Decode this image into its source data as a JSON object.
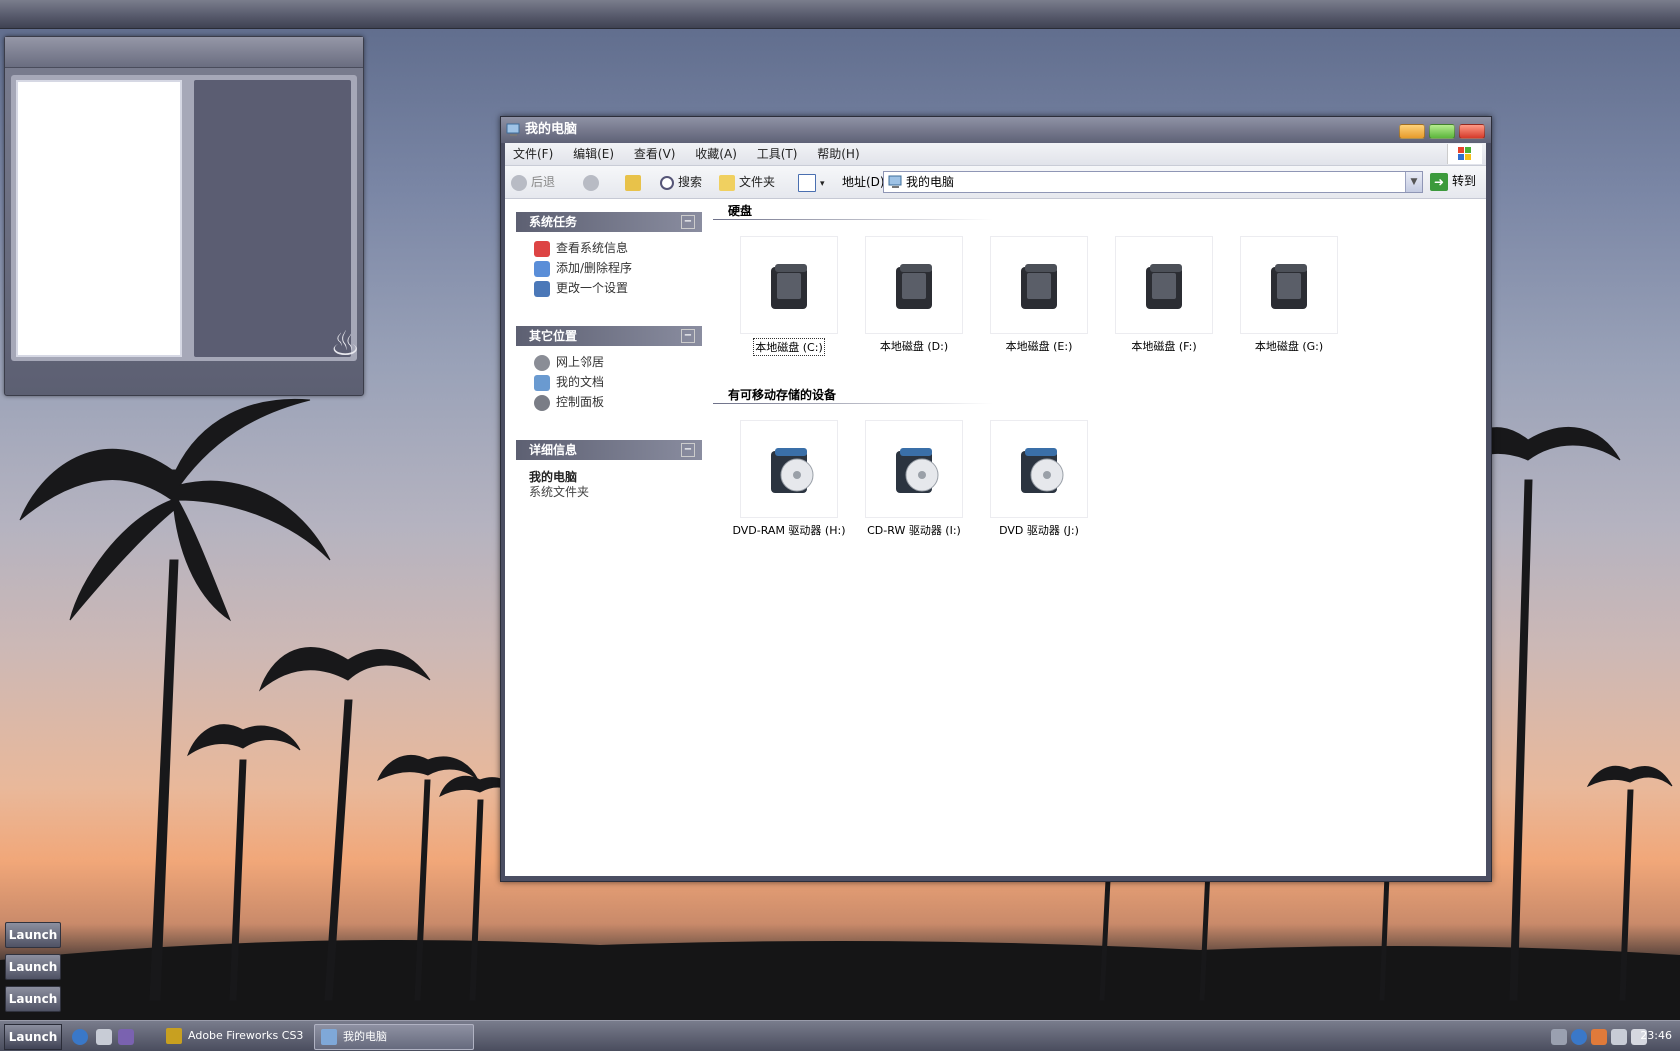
{
  "window": {
    "title": "我的电脑",
    "menu": [
      "文件(F)",
      "编辑(E)",
      "查看(V)",
      "收藏(A)",
      "工具(T)",
      "帮助(H)"
    ],
    "toolbar": {
      "back": "后退",
      "search": "搜索",
      "folders": "文件夹",
      "address_label": "地址(D)",
      "address_value": "我的电脑",
      "goto": "转到"
    },
    "taskpane": {
      "system_tasks": {
        "title": "系统任务",
        "items": [
          "查看系统信息",
          "添加/删除程序",
          "更改一个设置"
        ]
      },
      "other_places": {
        "title": "其它位置",
        "items": [
          "网上邻居",
          "我的文档",
          "控制面板"
        ]
      },
      "details": {
        "title": "详细信息",
        "name": "我的电脑",
        "type": "系统文件夹"
      }
    },
    "sections": {
      "hard_disks": {
        "title": "硬盘",
        "drives": [
          "本地磁盘 (C:)",
          "本地磁盘 (D:)",
          "本地磁盘 (E:)",
          "本地磁盘 (F:)",
          "本地磁盘 (G:)"
        ]
      },
      "removable": {
        "title": "有可移动存储的设备",
        "drives": [
          "DVD-RAM 驱动器 (H:)",
          "CD-RW 驱动器 (I:)",
          "DVD 驱动器 (J:)"
        ]
      }
    }
  },
  "desktop": {
    "launch_buttons": [
      "Launch",
      "Launch",
      "Launch"
    ]
  },
  "taskbar": {
    "launch": "Launch",
    "tasks": [
      "Adobe Fireworks CS3",
      "我的电脑"
    ],
    "clock": "23:46"
  },
  "colors": {
    "titlebar": "#5e6176",
    "taskpane_header": "#5d6072",
    "minimize": "#f0b040",
    "maximize": "#6cc04a",
    "close": "#d84030"
  }
}
